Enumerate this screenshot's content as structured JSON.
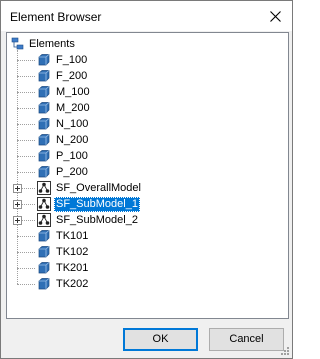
{
  "window": {
    "title": "Element Browser"
  },
  "tree": {
    "root": {
      "label": "Elements",
      "icon": "folder-tree-icon"
    },
    "items": [
      {
        "label": "F_100",
        "icon": "element-cube-icon",
        "expandable": false,
        "selected": false
      },
      {
        "label": "F_200",
        "icon": "element-cube-icon",
        "expandable": false,
        "selected": false
      },
      {
        "label": "M_100",
        "icon": "element-cube-icon",
        "expandable": false,
        "selected": false
      },
      {
        "label": "M_200",
        "icon": "element-cube-icon",
        "expandable": false,
        "selected": false
      },
      {
        "label": "N_100",
        "icon": "element-cube-icon",
        "expandable": false,
        "selected": false
      },
      {
        "label": "N_200",
        "icon": "element-cube-icon",
        "expandable": false,
        "selected": false
      },
      {
        "label": "P_100",
        "icon": "element-cube-icon",
        "expandable": false,
        "selected": false
      },
      {
        "label": "P_200",
        "icon": "element-cube-icon",
        "expandable": false,
        "selected": false
      },
      {
        "label": "SF_OverallModel",
        "icon": "model-network-icon",
        "expandable": true,
        "selected": false
      },
      {
        "label": "SF_SubModel_1",
        "icon": "model-network-icon",
        "expandable": true,
        "selected": true
      },
      {
        "label": "SF_SubModel_2",
        "icon": "model-network-icon",
        "expandable": true,
        "selected": false
      },
      {
        "label": "TK101",
        "icon": "element-cube-icon",
        "expandable": false,
        "selected": false
      },
      {
        "label": "TK102",
        "icon": "element-cube-icon",
        "expandable": false,
        "selected": false
      },
      {
        "label": "TK201",
        "icon": "element-cube-icon",
        "expandable": false,
        "selected": false
      },
      {
        "label": "TK202",
        "icon": "element-cube-icon",
        "expandable": false,
        "selected": false
      }
    ]
  },
  "buttons": {
    "ok": "OK",
    "cancel": "Cancel"
  },
  "colors": {
    "selection": "#0078d7",
    "cube": "#2f6fb5"
  }
}
